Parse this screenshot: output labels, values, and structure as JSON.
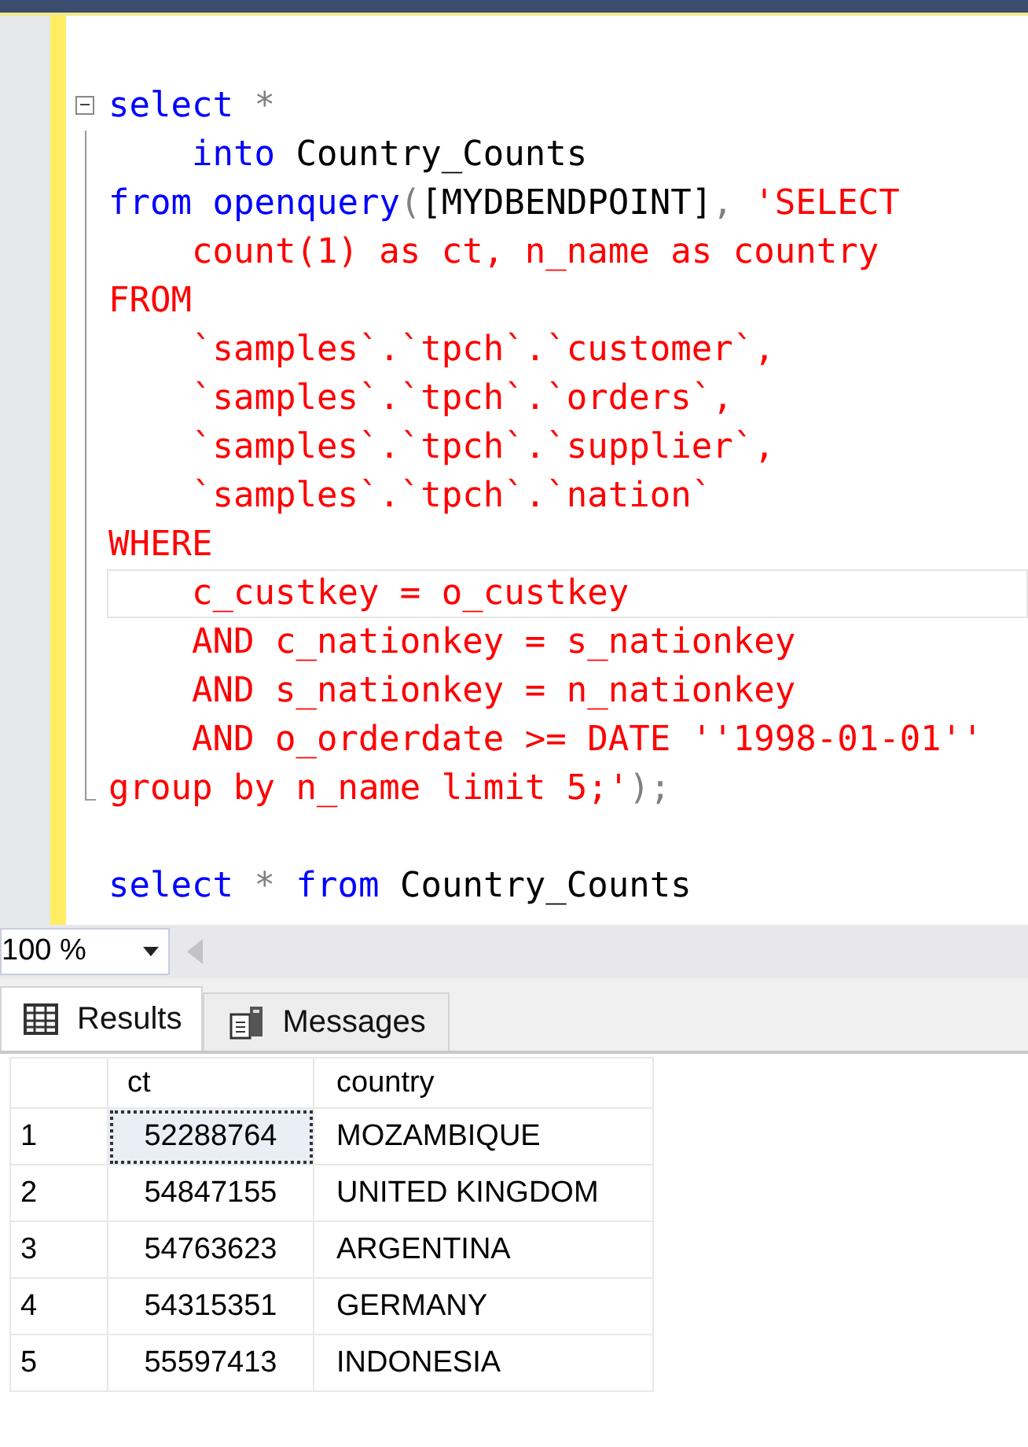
{
  "editor": {
    "lines": [
      {
        "current": false
      },
      {
        "current": false,
        "tokens": [
          {
            "text": "select",
            "kind": "keyword"
          },
          {
            "text": " *",
            "kind": "operator"
          }
        ],
        "children": [
          {
            "current": false,
            "tokens": [
              {
                "text": "    into",
                "kind": "keyword"
              },
              {
                "text": " Country_Counts",
                "kind": "plain"
              }
            ]
          },
          {
            "current": false,
            "tokens": [
              {
                "text": "from",
                "kind": "keyword"
              },
              {
                "text": " openquery",
                "kind": "function"
              },
              {
                "text": "(",
                "kind": "operator"
              },
              {
                "text": "[MYDBENDPOINT]",
                "kind": "plain"
              },
              {
                "text": ",",
                "kind": "operator"
              },
              {
                "text": " 'SELECT",
                "kind": "string"
              }
            ]
          },
          {
            "current": false,
            "tokens": [
              {
                "text": "    count(1) as ct, n_name as country",
                "kind": "string"
              }
            ]
          },
          {
            "current": false,
            "tokens": [
              {
                "text": "FROM",
                "kind": "string"
              }
            ]
          },
          {
            "current": false,
            "tokens": [
              {
                "text": "    `samples`.`tpch`.`customer`,",
                "kind": "string"
              }
            ]
          },
          {
            "current": false,
            "tokens": [
              {
                "text": "    `samples`.`tpch`.`orders`,",
                "kind": "string"
              }
            ]
          },
          {
            "current": false,
            "tokens": [
              {
                "text": "    `samples`.`tpch`.`supplier`,",
                "kind": "string"
              }
            ]
          },
          {
            "current": false,
            "tokens": [
              {
                "text": "    `samples`.`tpch`.`nation`",
                "kind": "string"
              }
            ]
          },
          {
            "current": false,
            "tokens": [
              {
                "text": "WHERE",
                "kind": "string"
              }
            ]
          },
          {
            "current": true,
            "tokens": [
              {
                "text": "    c_custkey = o_custkey",
                "kind": "string"
              }
            ]
          },
          {
            "current": false,
            "tokens": [
              {
                "text": "    AND c_nationkey = s_nationkey",
                "kind": "string"
              }
            ]
          },
          {
            "current": false,
            "tokens": [
              {
                "text": "    AND s_nationkey = n_nationkey",
                "kind": "string"
              }
            ]
          },
          {
            "current": false,
            "tokens": [
              {
                "text": "    AND o_orderdate >= DATE ''1998-01-01''",
                "kind": "string"
              }
            ]
          },
          {
            "current": false,
            "tokens": [
              {
                "text": "group by n_name limit 5;'",
                "kind": "string"
              },
              {
                "text": ");",
                "kind": "operator"
              }
            ]
          }
        ]
      },
      {
        "current": false
      },
      {
        "current": false,
        "tokens": [
          {
            "text": "select",
            "kind": "keyword"
          },
          {
            "text": " *",
            "kind": "operator"
          },
          {
            "text": " from",
            "kind": "keyword"
          },
          {
            "text": " Country_Counts",
            "kind": "plain"
          }
        ]
      }
    ]
  },
  "zoom": {
    "value": "100 %"
  },
  "tabs": [
    {
      "label": "Results",
      "selected": true,
      "kind": "grid"
    },
    {
      "label": "Messages",
      "selected": false,
      "kind": "messages"
    }
  ],
  "grid": {
    "columns": [
      "ct",
      "country"
    ],
    "rows": [
      {
        "number": "1",
        "cells": [
          {
            "text": "52288764",
            "focused": true
          },
          {
            "text": "MOZAMBIQUE",
            "focused": false
          }
        ]
      },
      {
        "number": "2",
        "cells": [
          {
            "text": "54847155",
            "focused": false
          },
          {
            "text": "UNITED KINGDOM",
            "focused": false
          }
        ]
      },
      {
        "number": "3",
        "cells": [
          {
            "text": "54763623",
            "focused": false
          },
          {
            "text": "ARGENTINA",
            "focused": false
          }
        ]
      },
      {
        "number": "4",
        "cells": [
          {
            "text": "54315351",
            "focused": false
          },
          {
            "text": "GERMANY",
            "focused": false
          }
        ]
      },
      {
        "number": "5",
        "cells": [
          {
            "text": "55597413",
            "focused": false
          },
          {
            "text": "INDONESIA",
            "focused": false
          }
        ]
      }
    ]
  }
}
